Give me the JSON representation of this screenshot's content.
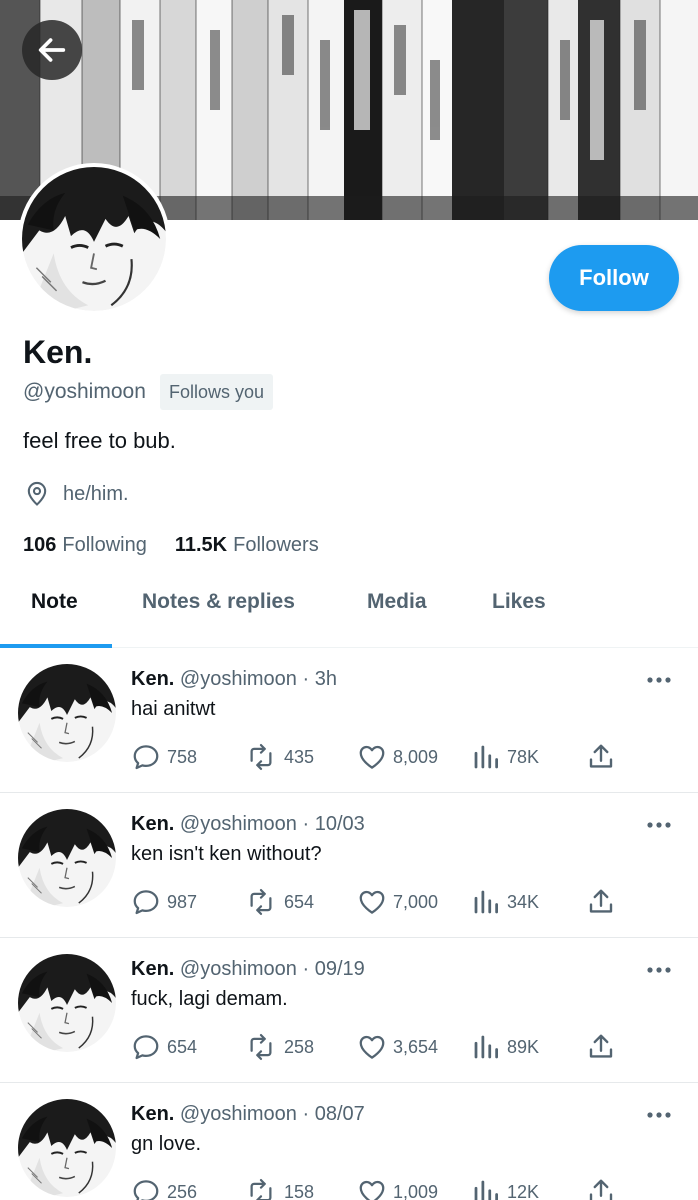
{
  "banner": {
    "alt": "manga bookshelf banner"
  },
  "profile": {
    "display_name": "Ken.",
    "handle": "@yoshimoon",
    "follows_badge": "Follows you",
    "bio": "feel free to bub.",
    "location": "he/him.",
    "following_count": "106",
    "following_label": "Following",
    "followers_count": "11.5K",
    "followers_label": "Followers",
    "follow_button": "Follow"
  },
  "tabs": [
    {
      "label": "Note",
      "active": true
    },
    {
      "label": "Notes & replies",
      "active": false
    },
    {
      "label": "Media",
      "active": false
    },
    {
      "label": "Likes",
      "active": false
    }
  ],
  "tweets": [
    {
      "name": "Ken.",
      "handle": "@yoshimoon",
      "sep": "·",
      "time": "3h",
      "text": "hai anitwt",
      "replies": "758",
      "retweets": "435",
      "likes": "8,009",
      "views": "78K"
    },
    {
      "name": "Ken.",
      "handle": "@yoshimoon",
      "sep": "·",
      "time": "10/03",
      "text": "ken isn't ken without?",
      "replies": "987",
      "retweets": "654",
      "likes": "7,000",
      "views": "34K"
    },
    {
      "name": "Ken.",
      "handle": "@yoshimoon",
      "sep": "·",
      "time": "09/19",
      "text": "fuck, lagi demam.",
      "replies": "654",
      "retweets": "258",
      "likes": "3,654",
      "views": "89K"
    },
    {
      "name": "Ken.",
      "handle": "@yoshimoon",
      "sep": "·",
      "time": "08/07",
      "text": "gn love.",
      "replies": "256",
      "retweets": "158",
      "likes": "1,009",
      "views": "12K"
    }
  ],
  "colors": {
    "accent": "#1d9bf0",
    "text": "#0f1419",
    "secondary": "#536471"
  },
  "icons": [
    "back-arrow-icon",
    "location-pin-icon",
    "reply-icon",
    "retweet-icon",
    "like-icon",
    "views-icon",
    "share-icon",
    "more-icon"
  ]
}
